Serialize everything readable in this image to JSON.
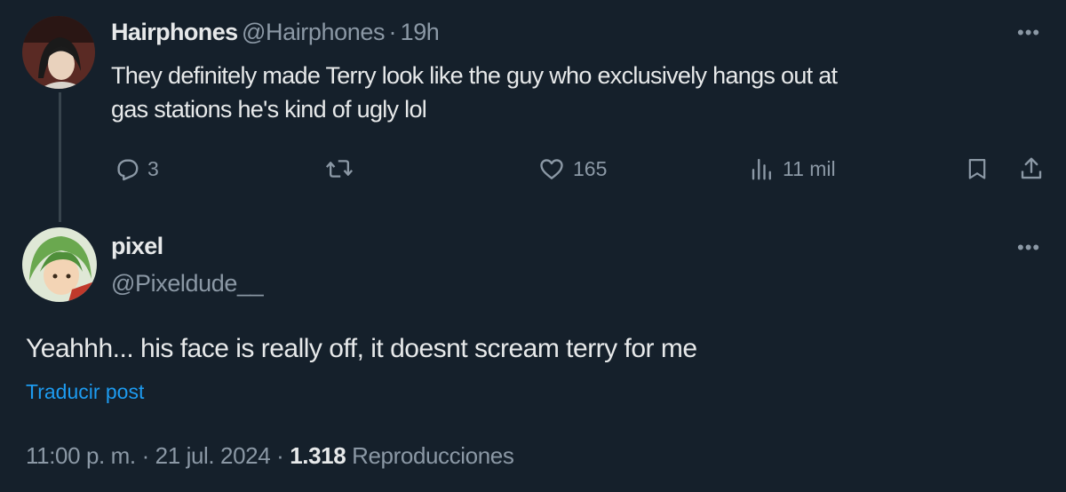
{
  "parent_tweet": {
    "display_name": "Hairphones",
    "handle": "@Hairphones",
    "separator": "·",
    "time": "19h",
    "text_line1": "They definitely made Terry look like the guy who exclusively hangs out at",
    "text_line2": "gas stations he's kind of ugly lol",
    "actions": {
      "reply_count": "3",
      "like_count": "165",
      "view_count": "11 mil"
    },
    "icons": [
      "reply-icon",
      "retweet-icon",
      "like-icon",
      "views-icon",
      "bookmark-icon",
      "share-icon",
      "more-icon"
    ]
  },
  "reply_tweet": {
    "display_name": "pixel",
    "handle": "@Pixeldude__",
    "text": "Yeahhh... his face is really off, it doesnt scream terry for me",
    "translate_label": "Traducir post",
    "timestamp": "11:00 p. m. · 21 jul. 2024",
    "meta_separator": "·",
    "views_count": "1.318",
    "views_label": "Reproducciones"
  },
  "colors": {
    "background": "#15202b",
    "text_primary": "#e7e9ea",
    "text_secondary": "#8b98a5",
    "link": "#1d9bf0",
    "thread_line": "#38444d"
  }
}
